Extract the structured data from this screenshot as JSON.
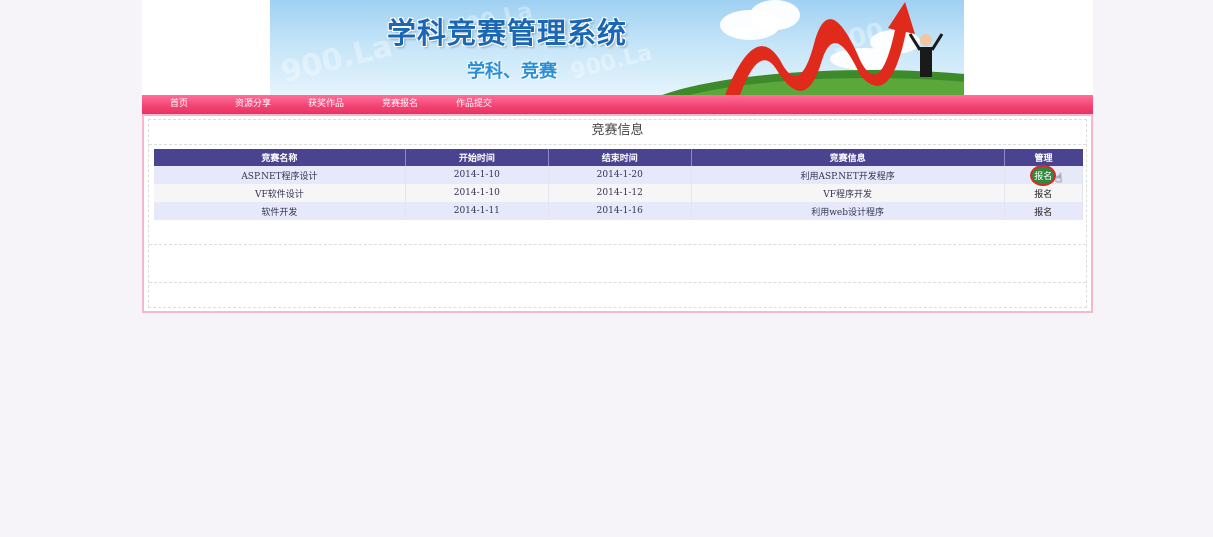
{
  "header": {
    "title": "学科竞赛管理系统",
    "subtitle": "学科、竞赛"
  },
  "nav": {
    "items": [
      "首页",
      "资源分享",
      "获奖作品",
      "竞赛报名",
      "作品提交"
    ]
  },
  "section": {
    "title": "竞赛信息"
  },
  "table": {
    "columns": [
      "竞赛名称",
      "开始时间",
      "结束时间",
      "竞赛信息",
      "管理"
    ],
    "rows": [
      {
        "name": "ASP.NET程序设计",
        "start": "2014-1-10",
        "end": "2014-1-20",
        "info": "利用ASP.NET开发程序",
        "action": "报名"
      },
      {
        "name": "VF软件设计",
        "start": "2014-1-10",
        "end": "2014-1-12",
        "info": "VF程序开发",
        "action": "报名"
      },
      {
        "name": "软件开发",
        "start": "2014-1-11",
        "end": "2014-1-16",
        "info": "利用web设计程序",
        "action": "报名"
      }
    ]
  },
  "colors": {
    "nav_bar": "#f24274",
    "table_header": "#4a4490",
    "frame_border": "#f7b8cb"
  }
}
